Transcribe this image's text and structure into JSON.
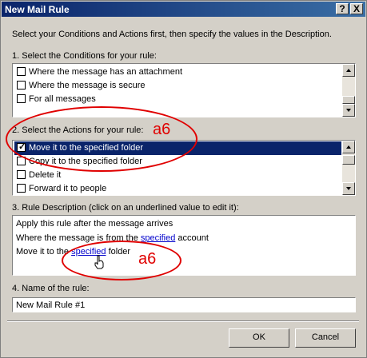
{
  "window": {
    "title": "New Mail Rule",
    "help_label": "?",
    "close_label": "X"
  },
  "intro": "Select your Conditions and Actions first, then specify the values in the Description.",
  "conditions": {
    "label": "1. Select the Conditions for your rule:",
    "items": [
      {
        "label": "Where the message has an attachment",
        "checked": false
      },
      {
        "label": "Where the message is secure",
        "checked": false
      },
      {
        "label": "For all messages",
        "checked": false
      }
    ]
  },
  "actions": {
    "label": "2. Select the Actions for your rule:",
    "items": [
      {
        "label": "Move it to the specified folder",
        "checked": true,
        "selected": true
      },
      {
        "label": "Copy it to the specified folder",
        "checked": false
      },
      {
        "label": "Delete it",
        "checked": false
      },
      {
        "label": "Forward it to people",
        "checked": false
      }
    ]
  },
  "description": {
    "label": "3. Rule Description (click on an underlined value to edit it):",
    "line1": "Apply this rule after the message arrives",
    "line2_pre": "Where the message is from the ",
    "line2_link": "specified",
    "line2_post": " account",
    "line3_pre": "Move it to the ",
    "line3_link": "specified",
    "line3_post": " folder"
  },
  "name": {
    "label": "4. Name of the rule:",
    "value": "New Mail Rule #1"
  },
  "buttons": {
    "ok": "OK",
    "cancel": "Cancel"
  },
  "annotations": {
    "a1": "a6",
    "a2": "a6"
  },
  "colors": {
    "title_bar": "#0a246a",
    "selection": "#0a246a",
    "annotation": "#e00000",
    "link": "#0000cc"
  }
}
